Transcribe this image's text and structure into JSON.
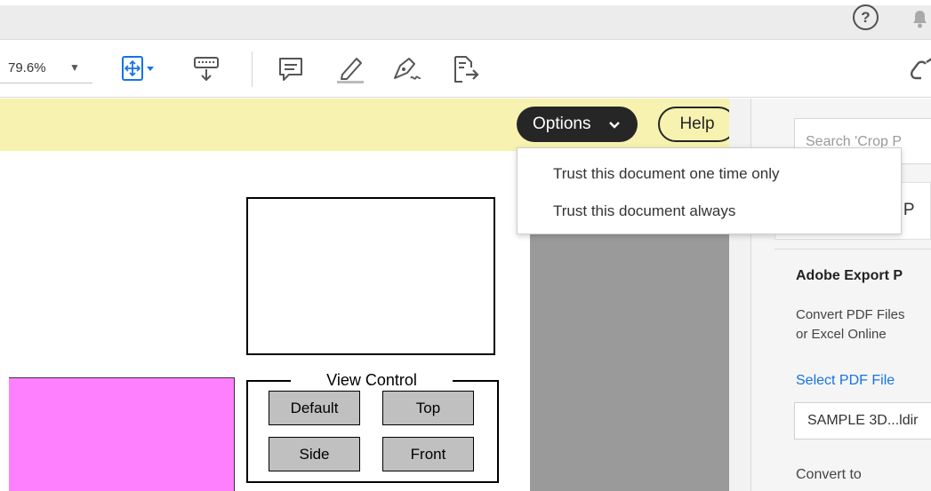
{
  "topbar": {
    "help_glyph": "?",
    "help_icon": "help-circle-icon",
    "bell_icon": "bell-icon"
  },
  "toolbar": {
    "zoom_value": "79.6%",
    "zoom_caret": "▼",
    "tools": [
      "fit-page-icon",
      "scroll-mode-icon",
      "comment-icon",
      "highlight-icon",
      "sign-icon",
      "export-icon",
      "link-icon"
    ]
  },
  "notice": {
    "options_label": "Options",
    "options_chevron": "❯",
    "help_label": "Help"
  },
  "options_menu": {
    "items": [
      "Trust this document one time only",
      "Trust this document always"
    ]
  },
  "document": {
    "view_control_title": "View Control",
    "buttons": [
      "Default",
      "Top",
      "Side",
      "Front"
    ],
    "colors": {
      "pink_panel": "#ff80ff",
      "button_fill": "#c0c0c0",
      "gray_area": "#9a9a9a"
    }
  },
  "right_pane": {
    "search_placeholder": "Search 'Crop P",
    "card_text": "rt P",
    "export_title": "Adobe Export P",
    "export_desc_line1": "Convert PDF Files",
    "export_desc_line2": "or Excel Online",
    "select_link": "Select PDF File",
    "file_name": "SAMPLE 3D...ldir",
    "convert_to": "Convert to"
  },
  "colors": {
    "notice_bg": "#f7f2b0",
    "accent": "#1473e6",
    "dark_button": "#262626"
  }
}
